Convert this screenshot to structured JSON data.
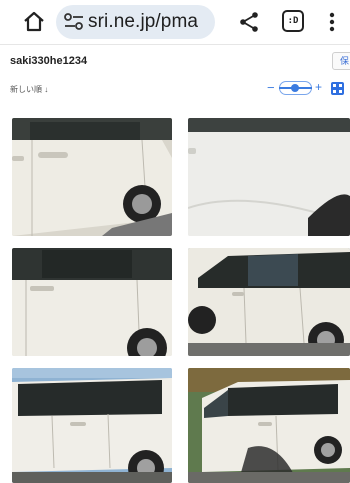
{
  "browser": {
    "url": "sri.ne.jp/pma",
    "tabs_label": ":D"
  },
  "header": {
    "username": "saki330he1234",
    "right_button": "保"
  },
  "toolbar": {
    "sort_label": "新しい順 ↓",
    "zoom_minus": "−",
    "zoom_plus": "+",
    "accent_color": "#3b7be0"
  },
  "photos": [
    {
      "subject": "white-minivan-side-panel",
      "icon": "photo-thumbnail"
    },
    {
      "subject": "white-minivan-door-closeup",
      "icon": "photo-thumbnail"
    },
    {
      "subject": "white-minivan-rear-side",
      "icon": "photo-thumbnail"
    },
    {
      "subject": "white-minivan-front-three-quarter",
      "icon": "photo-thumbnail"
    },
    {
      "subject": "white-minivan-rear-quarter",
      "icon": "photo-thumbnail"
    },
    {
      "subject": "white-minivan-side-shadow",
      "icon": "photo-thumbnail"
    }
  ]
}
